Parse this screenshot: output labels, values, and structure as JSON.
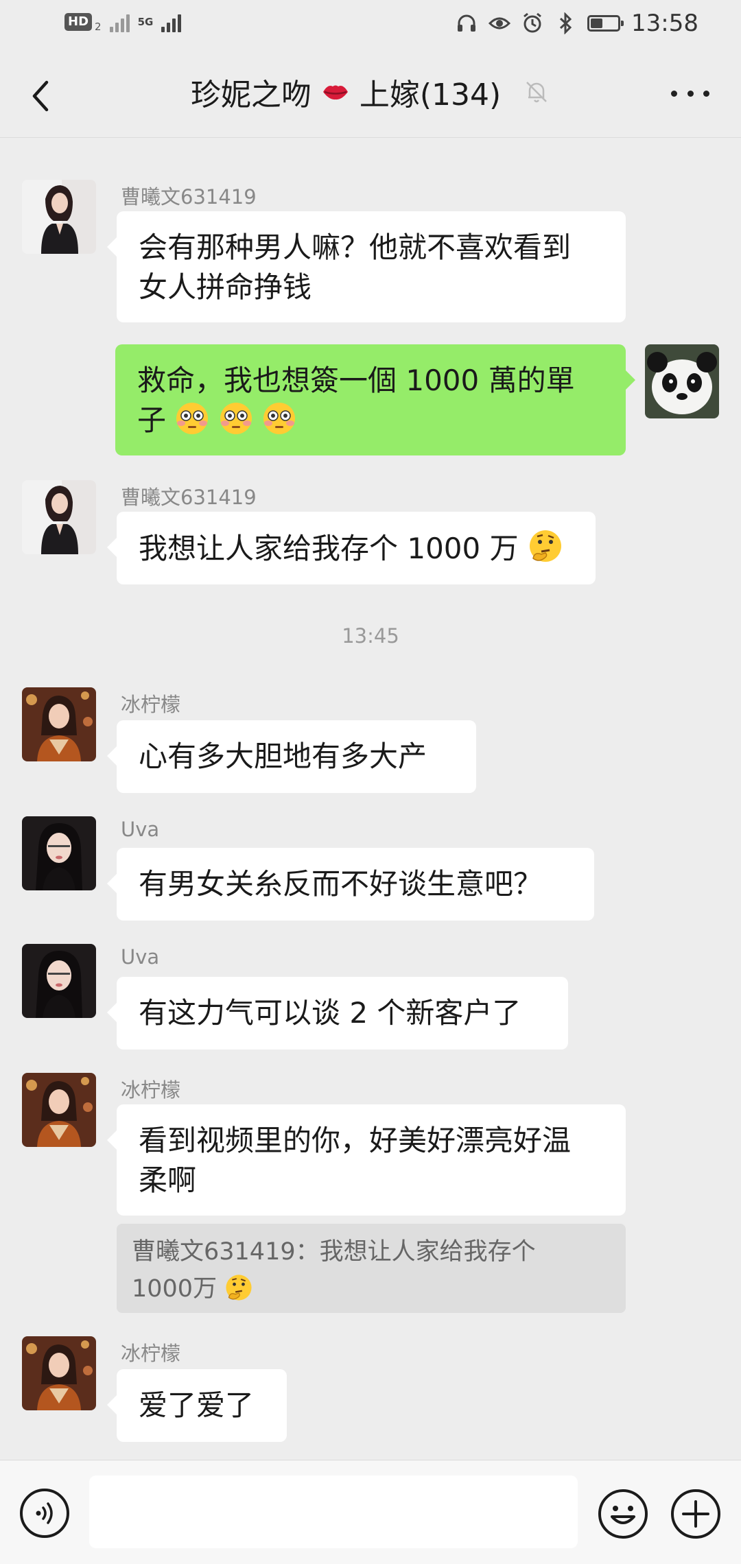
{
  "status_bar": {
    "hd": "HD",
    "hd_sub": "2",
    "network": "5G",
    "time": "13:58",
    "battery_level": 0.45
  },
  "header": {
    "title_before": "珍妮之吻",
    "title_after": "上嫁(134)"
  },
  "messages": [
    {
      "sender": "曹曦文631419",
      "line1": "会有那种男人嘛？他就不喜欢看到",
      "line2": "女人拼命挣钱"
    },
    {
      "line1": "救命，我也想簽一個 1000 萬的單",
      "line2": "子"
    },
    {
      "sender": "曹曦文631419",
      "text": "我想让人家给我存个 1000 万"
    },
    {
      "sender": "冰柠檬",
      "text": "心有多大胆地有多大产"
    },
    {
      "sender": "Uva",
      "text": "有男女关糸反而不好谈生意吧？"
    },
    {
      "sender": "Uva",
      "text": "有这力气可以谈 2 个新客户了"
    },
    {
      "sender": "冰柠檬",
      "line1": "看到视频里的你，好美好漂亮好温",
      "line2": "柔啊",
      "quote_line1": "曹曦文631419：我想让人家给我存个",
      "quote_line2": "1000万"
    },
    {
      "sender": "冰柠檬",
      "text": "爱了爱了"
    }
  ],
  "time_divider": "13:45",
  "colors": {
    "background": "#ededed",
    "self_bubble": "#95ec69",
    "other_bubble": "#ffffff"
  }
}
